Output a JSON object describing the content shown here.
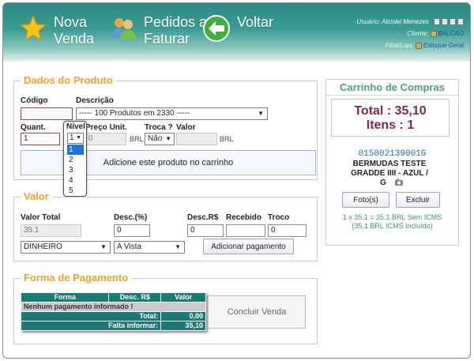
{
  "header": {
    "nova_venda": [
      "Nova",
      "Venda"
    ],
    "pedidos": [
      "Pedidos a",
      "Faturar"
    ],
    "voltar": "Voltar",
    "usuario_label": "Usuário:",
    "usuario_value": "Alcislei Menezes",
    "cliente_label": "Cliente:",
    "cliente_value": "BALCAO",
    "filial_label": "Filial/Loja:",
    "filial_value": "Estoque Geral"
  },
  "produto": {
    "legend": "Dados do Produto",
    "codigo_label": "Código",
    "codigo_value": "",
    "descricao_label": "Descrição",
    "descricao_value": "----- 100 Produtos em 2330 -----",
    "quant_label": "Quant.",
    "quant_value": "1",
    "nivel_label": "Nível",
    "nivel_value": "1",
    "nivel_options": [
      "1",
      "2",
      "3",
      "4",
      "5"
    ],
    "preco_label": "Preço Unit.",
    "preco_value": "0",
    "preco_currency": "BRL",
    "troca_label": "Troca ?",
    "troca_value": "Não",
    "valor_label": "Valor",
    "valor_value": "",
    "valor_currency": "BRL",
    "add_button": "Adicione este produto no carrinho"
  },
  "valor": {
    "legend": "Valor",
    "total_label": "Valor Total",
    "total_value": "35.1",
    "desc_pct_label": "Desc.(%)",
    "desc_pct_value": "0",
    "desc_rs_label": "Desc.R$",
    "desc_rs_value": "0",
    "recebido_label": "Recebido",
    "recebido_value": "",
    "troco_label": "Troco",
    "troco_value": "0",
    "forma_value": "DINHEIRO",
    "condicao_value": "A Vista",
    "add_pagamento": "Adicionar pagamento"
  },
  "pagamento": {
    "legend": "Forma de Pagamento",
    "col_forma": "Forma",
    "col_desc": "Desc. R$",
    "col_valor": "Valor",
    "empty_msg": "Nenhum pagamento informado !",
    "total_label": "Total:",
    "total_value": "0,00",
    "falta_label": "Falta informar:",
    "falta_value": "35,10",
    "concluir": "Concluir Venda"
  },
  "carrinho": {
    "title": "Carrinho de Compras",
    "total_label": "Total :",
    "total_value": "35,10",
    "itens_label": "Itens :",
    "itens_value": "1",
    "codigo": "015002139001G",
    "nome_1": "BERMUDAS TESTE",
    "nome_2": "GRADDE IIII - AZUL /",
    "nome_3": "G",
    "fotos_button": "Foto(s)",
    "excluir_button": "Excluir",
    "note_1": "1 x 35.1 = 35.1 BRL Sem ICMS",
    "note_2": "(35.1 BRL ICMS Incluído)"
  },
  "colors": {
    "header_teal": "#2c8a83",
    "legend_orange": "#f2a02a",
    "cart_green": "#4aa07c",
    "total_maroon": "#7b2656",
    "table_teal": "#1b7a74",
    "select_blue": "#1e72d8"
  },
  "icons": [
    "star-icon",
    "users-icon",
    "back-arrow-icon",
    "tools-icon",
    "lock-icon",
    "trash-icon",
    "print-icon",
    "client-icon",
    "store-icon",
    "photo-icon"
  ]
}
